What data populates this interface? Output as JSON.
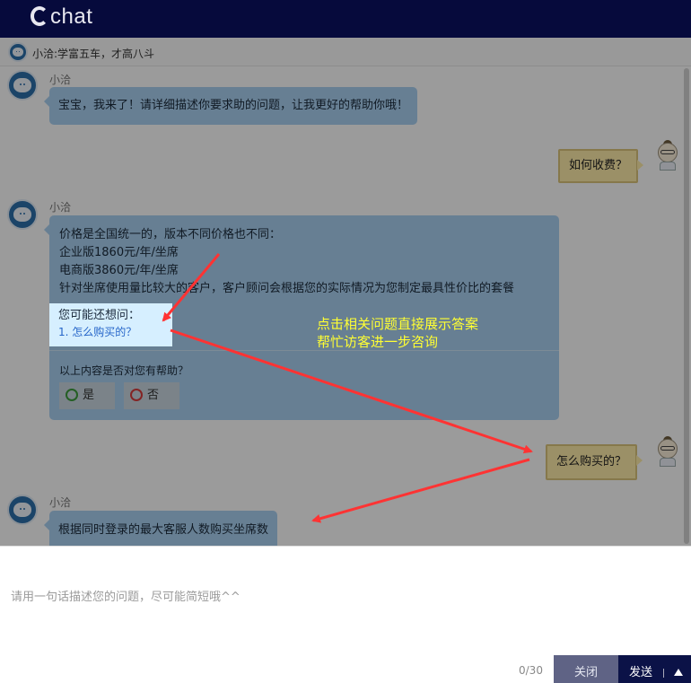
{
  "app": {
    "logo_text": "chat"
  },
  "notice": {
    "text": "小洽:学富五车，才高八斗"
  },
  "messages": [
    {
      "sender": "小洽",
      "text": "宝宝，我来了！请详细描述你要求助的问题，让我更好的帮助你哦！"
    },
    {
      "text": "如何收费？"
    },
    {
      "sender": "小洽",
      "lines": [
        "价格是全国统一的，版本不同价格也不同：",
        "企业版1860元/年/坐席",
        "电商版3860元/年/坐席",
        "针对坐席使用量比较大的客户，客户顾问会根据您的实际情况为您制定最具性价比的套餐"
      ],
      "suggest_title": "您可能还想问：",
      "suggest_item": "1. 怎么购买的？",
      "feedback_question": "以上内容是否对您有帮助？",
      "yes_label": "是",
      "no_label": "否"
    },
    {
      "text": "怎么购买的？"
    },
    {
      "sender": "小洽",
      "text": "根据同时登录的最大客服人数购买坐席数"
    }
  ],
  "annotation": {
    "line1": "点击相关问题直接展示答案",
    "line2": "帮忙访客进一步咨询"
  },
  "input": {
    "placeholder": "请用一句话描述您的问题，尽可能简短哦^^",
    "counter": "0/30"
  },
  "buttons": {
    "close": "关闭",
    "send": "发送"
  },
  "colors": {
    "topbar": "#060a3c",
    "robot_bubble": "#a6cdee",
    "user_bubble": "#fbe8a6",
    "annotation": "#ffff33",
    "arrow": "#ff3333"
  }
}
